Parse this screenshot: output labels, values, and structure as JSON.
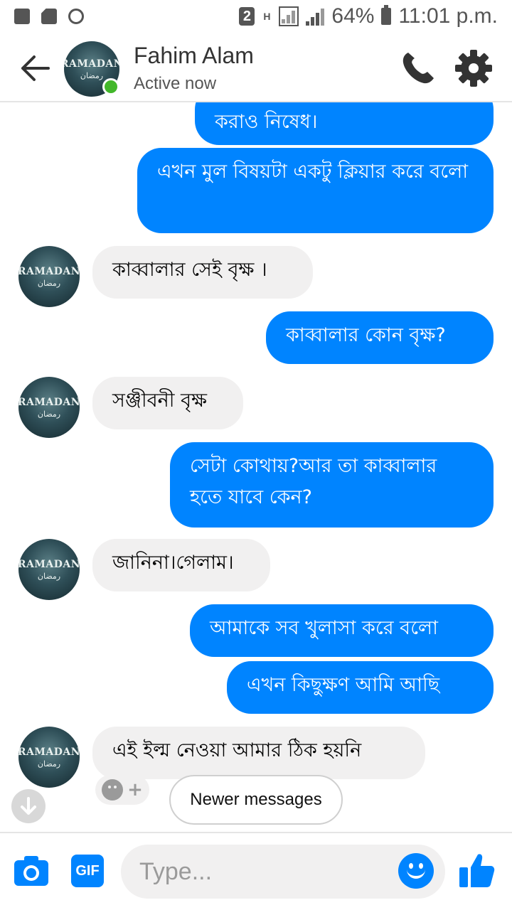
{
  "status_bar": {
    "badge": "2",
    "network": "H",
    "battery": "64%",
    "time": "11:01 p.m."
  },
  "header": {
    "contact_name": "Fahim Alam",
    "contact_status": "Active now",
    "avatar_text": "RAMADAN",
    "avatar_subtext": "رمضان"
  },
  "messages": [
    {
      "from": "me",
      "text": "করাও নিষেধ।"
    },
    {
      "from": "me",
      "text": "এখন মুল বিষয়টা একটু ক্লিয়ার করে বলো"
    },
    {
      "from": "them",
      "text": "কাব্বালার সেই বৃক্ষ ।"
    },
    {
      "from": "me",
      "text": "কাব্বালার কোন বৃক্ষ?"
    },
    {
      "from": "them",
      "text": "সঞ্জীবনী বৃক্ষ"
    },
    {
      "from": "me",
      "text": "সেটা কোথায়?আর তা কাব্বালার হতে যাবে কেন?"
    },
    {
      "from": "them",
      "text": "জানিনা।গেলাম।"
    },
    {
      "from": "me",
      "text": "আমাকে সব খুলাসা করে বলো"
    },
    {
      "from": "me",
      "text": "এখন কিছুক্ষণ আমি আছি"
    },
    {
      "from": "them",
      "text": "এই ইল্ম নেওয়া আমার ঠিক হয়নি"
    }
  ],
  "reaction": {
    "plus": "+"
  },
  "newer_messages_label": "Newer messages",
  "composer": {
    "gif_label": "GIF",
    "placeholder": "Type..."
  },
  "colors": {
    "accent": "#0084ff",
    "incoming_bubble": "#f1f0f0",
    "online": "#42b72a"
  }
}
